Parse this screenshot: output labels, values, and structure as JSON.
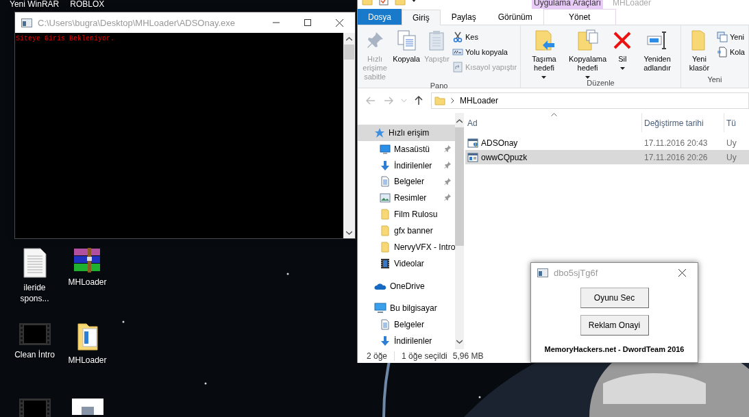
{
  "desktop": {
    "top_labels": [
      "Yeni WinRAR",
      "ROBLOX"
    ],
    "icons": [
      {
        "label": "ileride spons...",
        "kind": "document"
      },
      {
        "label": "MHLoader",
        "kind": "archive"
      },
      {
        "label": "Clean İntro",
        "kind": "video"
      },
      {
        "label": "MHLoader",
        "kind": "folder"
      },
      {
        "kind": "video"
      },
      {
        "kind": "thumbnail"
      }
    ]
  },
  "console": {
    "title": "C:\\Users\\bugra\\Desktop\\MHLoader\\ADSOnay.exe",
    "output": "Siteye Giris Bekleniyor."
  },
  "explorer": {
    "title": "MHLoader",
    "context_group": "Uygulama Araçları",
    "tabs": [
      {
        "label": "Dosya",
        "kind": "file",
        "selected": false
      },
      {
        "label": "Giriş",
        "kind": "normal",
        "selected": true
      },
      {
        "label": "Paylaş",
        "kind": "normal",
        "selected": false
      },
      {
        "label": "Görünüm",
        "kind": "normal",
        "selected": false
      },
      {
        "label": "Yönet",
        "kind": "context",
        "selected": false
      }
    ],
    "ribbon": [
      {
        "name": "Pano",
        "large": [
          {
            "label": "Hızlı erişime sabitle",
            "kind": "pin",
            "disabled": true,
            "dropdown": false
          },
          {
            "label": "Kopyala",
            "kind": "copy",
            "disabled": false,
            "dropdown": false
          },
          {
            "label": "Yapıştır",
            "kind": "paste",
            "disabled": true,
            "dropdown": false
          }
        ],
        "small": [
          {
            "label": "Kes",
            "kind": "cut",
            "disabled": false
          },
          {
            "label": "Yolu kopyala",
            "kind": "copy-path",
            "disabled": false
          },
          {
            "label": "Kısayol yapıştır",
            "kind": "paste-shortcut",
            "disabled": true
          }
        ]
      },
      {
        "name": "Düzenle",
        "large": [
          {
            "label": "Taşıma hedefi",
            "kind": "move",
            "disabled": false,
            "dropdown": true
          },
          {
            "label": "Kopyalama hedefi",
            "kind": "copy-to",
            "disabled": false,
            "dropdown": true
          },
          {
            "label": "Sil",
            "kind": "delete",
            "disabled": false,
            "dropdown": true
          },
          {
            "label": "Yeniden adlandır",
            "kind": "rename",
            "disabled": false,
            "dropdown": false
          }
        ]
      },
      {
        "name": "Yeni",
        "large": [
          {
            "label": "Yeni klasör",
            "kind": "new-folder",
            "disabled": false,
            "dropdown": false
          }
        ],
        "small": [
          {
            "label": "Yeni",
            "kind": "new-item",
            "disabled": false
          },
          {
            "label": "Kola",
            "kind": "easy-access",
            "disabled": false
          }
        ]
      }
    ],
    "address": "MHLoader",
    "nav": [
      {
        "label": "Hızlı erişim",
        "kind": "star",
        "selected": true,
        "children": [
          {
            "label": "Masaüstü",
            "kind": "desktop",
            "selected": false,
            "pinned": true
          },
          {
            "label": "İndirilenler",
            "kind": "download",
            "selected": false,
            "pinned": true
          },
          {
            "label": "Belgeler",
            "kind": "document",
            "selected": false,
            "pinned": true
          },
          {
            "label": "Resimler",
            "kind": "pictures",
            "selected": false,
            "pinned": true
          },
          {
            "label": "Film Rulosu",
            "kind": "folder",
            "selected": false,
            "pinned": false
          },
          {
            "label": "gfx banner",
            "kind": "folder",
            "selected": false,
            "pinned": false
          },
          {
            "label": "NervyVFX - Intro",
            "kind": "folder",
            "selected": false,
            "pinned": false
          },
          {
            "label": "Videolar",
            "kind": "video",
            "selected": false,
            "pinned": false
          }
        ]
      },
      {
        "label": "OneDrive",
        "kind": "cloud",
        "selected": false
      },
      {
        "label": "Bu bilgisayar",
        "kind": "computer",
        "selected": false,
        "children": [
          {
            "label": "Belgeler",
            "kind": "document",
            "selected": false,
            "pinned": false
          },
          {
            "label": "İndirilenler",
            "kind": "download",
            "selected": false,
            "pinned": false
          }
        ]
      }
    ],
    "columns": [
      {
        "label": "Ad",
        "sorted": true
      },
      {
        "label": "Değiştirme tarihi",
        "sorted": false
      },
      {
        "label": "Tü",
        "sorted": false
      }
    ],
    "rows": [
      {
        "name": "ADSOnay",
        "kind": "app-shield",
        "modified": "17.11.2016 20:43",
        "column_3": "Uy",
        "selected": false
      },
      {
        "name": "owwCQpuzk",
        "kind": "app",
        "modified": "17.11.2016 20:26",
        "column_3": "Uy",
        "selected": true
      }
    ],
    "status": {
      "count": "2 öğe",
      "selection": "1 öğe seçildi",
      "size": "5,96 MB"
    }
  },
  "dialog": {
    "title": "dbo5sjTg6f",
    "buttons": [
      "Oyunu Sec",
      "Reklam Onayi"
    ],
    "footer": "MemoryHackers.net - DwordTeam 2016"
  }
}
